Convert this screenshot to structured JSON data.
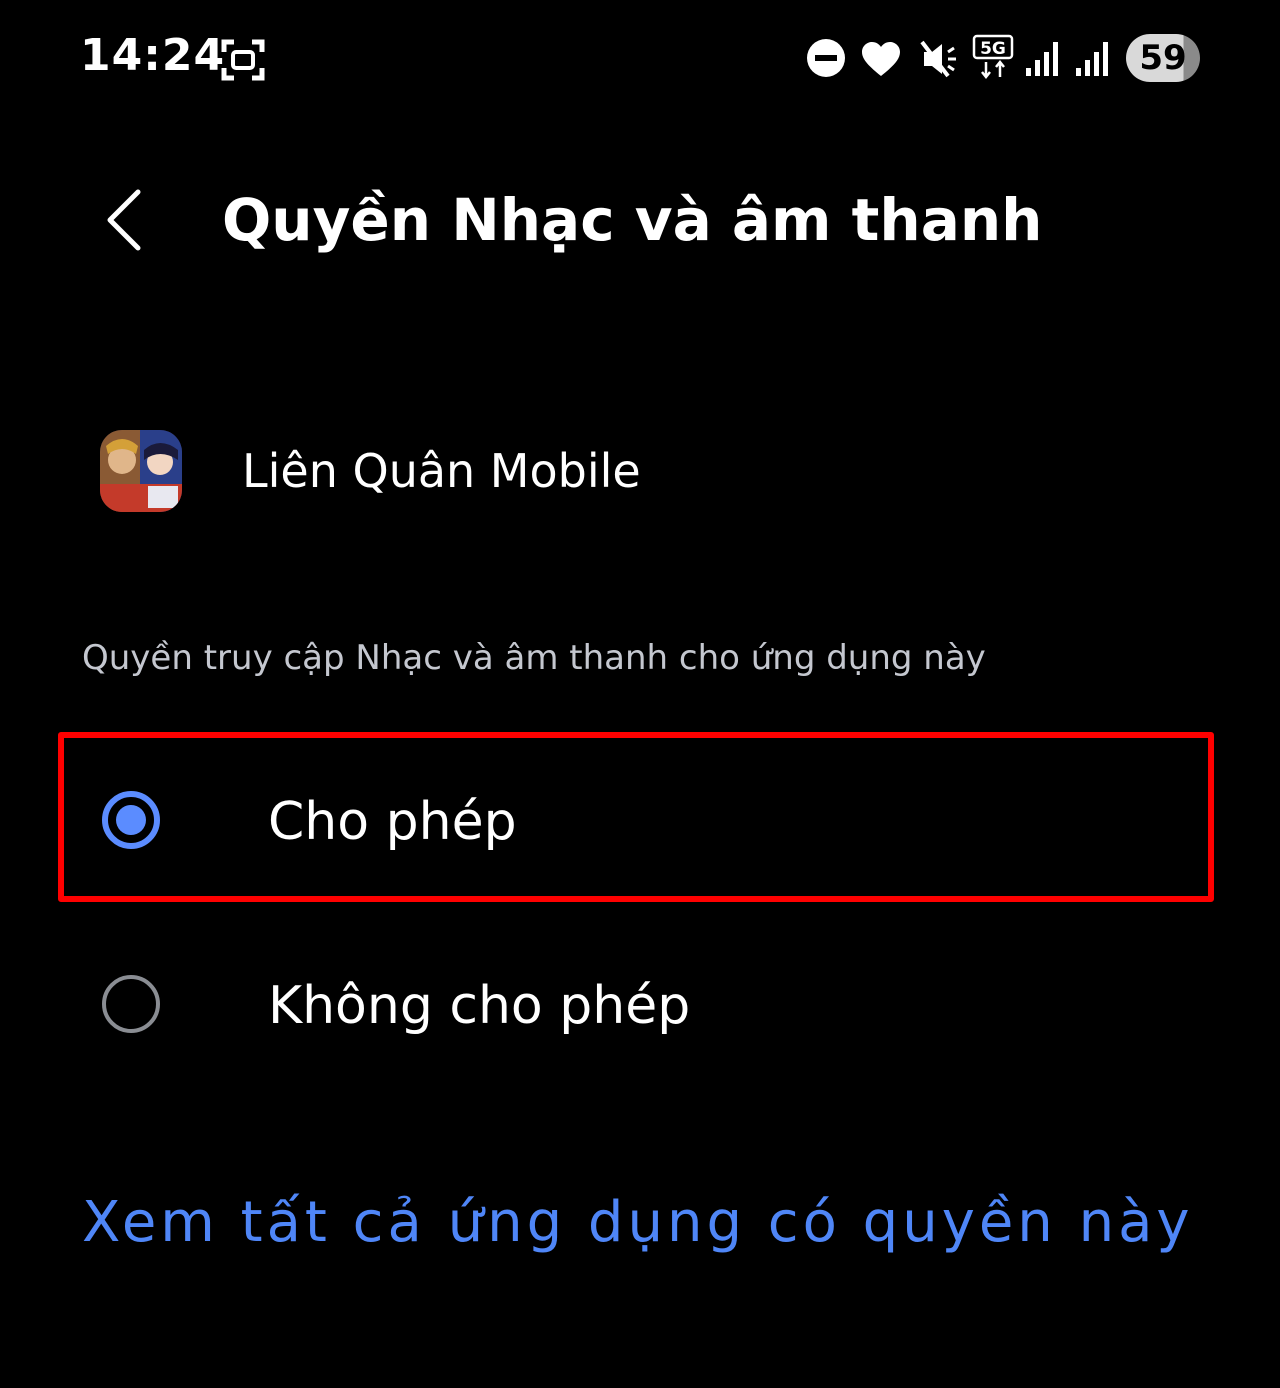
{
  "status_bar": {
    "time": "14:24",
    "battery": "59",
    "network": "5G",
    "icons": [
      "screenshot-icon",
      "do-not-disturb-icon",
      "heart-icon",
      "mute-icon",
      "5g-data-icon",
      "signal-icon",
      "signal-icon",
      "battery-icon"
    ]
  },
  "header": {
    "title": "Quyền Nhạc và âm thanh",
    "back_icon": "chevron-left-icon"
  },
  "app": {
    "name": "Liên Quân Mobile"
  },
  "section": {
    "label": "Quyền truy cập Nhạc và âm thanh cho ứng dụng này"
  },
  "options": [
    {
      "label": "Cho phép",
      "selected": true
    },
    {
      "label": "Không cho phép",
      "selected": false
    }
  ],
  "footer": {
    "link": "Xem tất cả ứng dụng có quyền này"
  },
  "colors": {
    "background": "#000000",
    "accent": "#5b8cff",
    "link": "#4f86f7",
    "highlight": "#ff0000",
    "secondary_text": "#c4c7cf"
  }
}
